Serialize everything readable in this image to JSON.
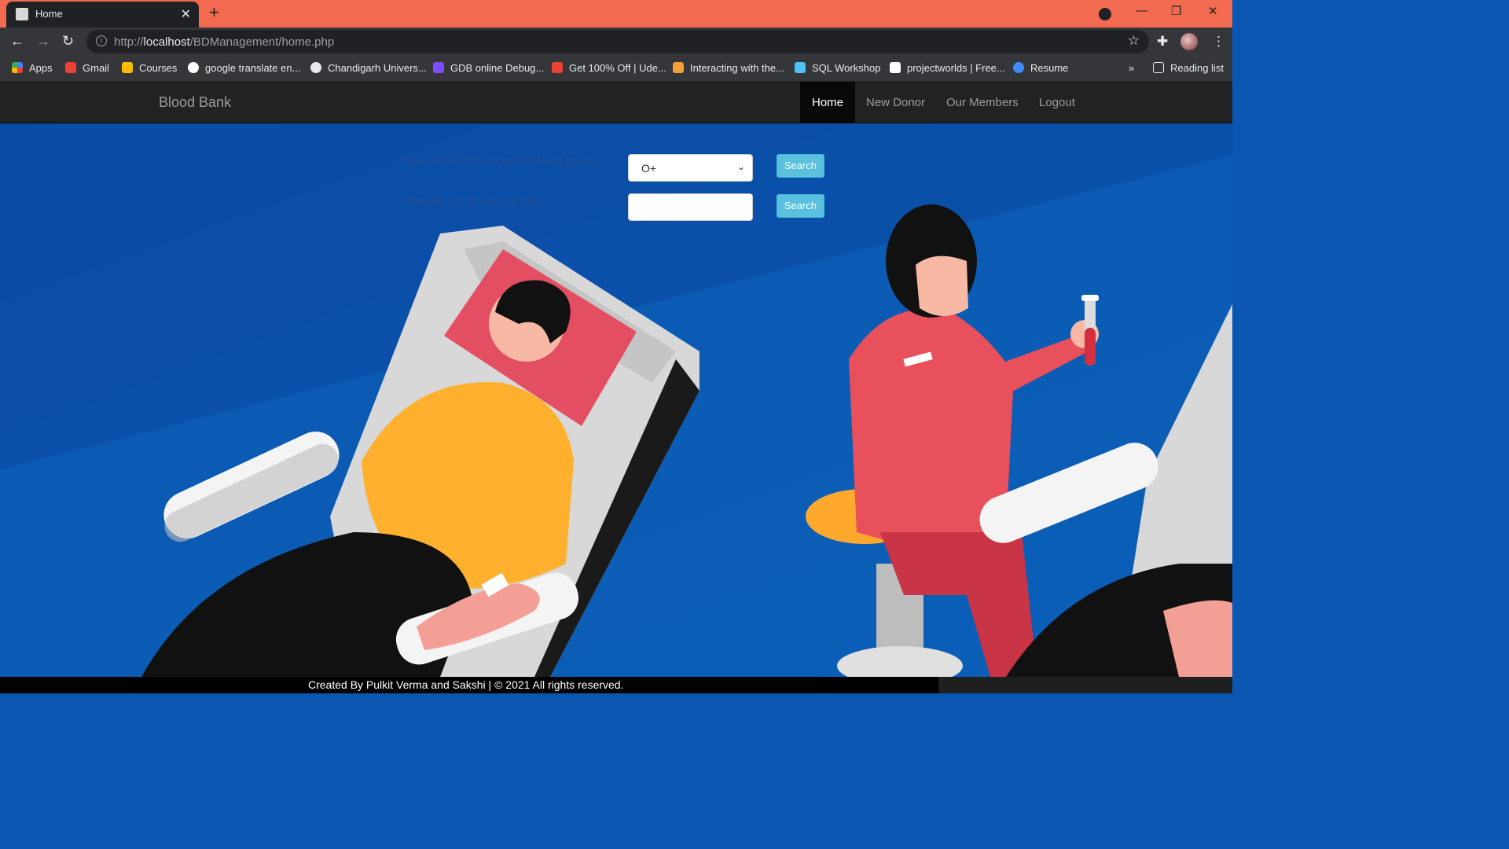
{
  "browser": {
    "tab_title": "Home",
    "url_host": "localhost",
    "url_prefix": "http://",
    "url_path": "/BDManagement/home.php",
    "bookmarks": [
      {
        "label": "Apps",
        "color": "#4285f4"
      },
      {
        "label": "Gmail",
        "color": "#ea4335"
      },
      {
        "label": "Courses",
        "color": "#fbbc04"
      },
      {
        "label": "google translate en...",
        "color": "#ffffff"
      },
      {
        "label": "Chandigarh Univers...",
        "color": "#e8eaed"
      },
      {
        "label": "GDB online Debug...",
        "color": "#7b4dff"
      },
      {
        "label": "Get 100% Off | Ude...",
        "color": "#ea4335"
      },
      {
        "label": "Interacting with the...",
        "color": "#f29d38"
      },
      {
        "label": "SQL Workshop",
        "color": "#4fc3f7"
      },
      {
        "label": "projectworlds | Free...",
        "color": "#ffffff"
      },
      {
        "label": "Resume",
        "color": "#3f8cff"
      }
    ],
    "reading_list": "Reading list"
  },
  "site": {
    "brand": "Blood Bank",
    "nav": [
      {
        "label": "Home",
        "active": true
      },
      {
        "label": "New Donor"
      },
      {
        "label": "Our Members"
      },
      {
        "label": "Logout"
      }
    ],
    "search_group_label": "Search for donor with blood group",
    "search_group_value": "O+",
    "search_city_label": "Search for donor by city",
    "search_city_value": "",
    "search_button": "Search"
  },
  "footer": "Created By Pulkit Verma and Sakshi | © 2021 All rights reserved."
}
